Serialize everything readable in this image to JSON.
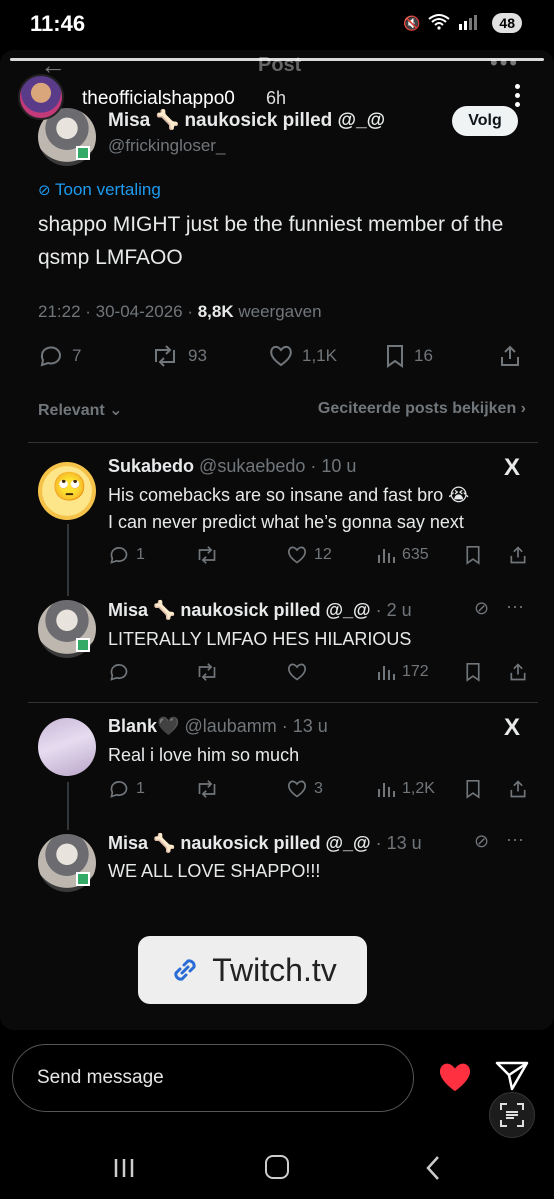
{
  "status": {
    "time": "11:46",
    "battery": "48"
  },
  "story": {
    "username": "theofficialshappo0",
    "time_ago": "6h"
  },
  "tweet": {
    "header_title": "Post",
    "author_name": "Misa 🦴 naukosick pilled @_@",
    "author_handle": "@frickingloser_",
    "follow_label": "Volg",
    "translate_label": "Toon vertaling",
    "text": "shappo MIGHT just be the funniest member of the qsmp LMFAOO",
    "meta_time": "21:22 · 30-04-2026 · ",
    "meta_views": "8,8K",
    "meta_views_label": " weergaven",
    "replies": "7",
    "reposts": "93",
    "likes": "1,1K",
    "bookmarks": "16",
    "sort_label": "Relevant ⌄",
    "quoted_label": "Geciteerde posts bekijken ›"
  },
  "replies": [
    {
      "name": "Sukabedo",
      "handle": "@sukaebedo · 10 u",
      "line1": "His comebacks are so insane and fast bro 😭",
      "line2": "I can never predict what he’s gonna say next",
      "replies": "1",
      "reposts": "",
      "likes": "12",
      "views": "635"
    },
    {
      "name": "Misa 🦴 naukosick pilled @_@",
      "handle": " · 2 u",
      "line1": "LITERALLY LMFAO HES HILARIOUS",
      "replies": "",
      "reposts": "",
      "likes": "",
      "views": "172"
    },
    {
      "name": "Blank🖤",
      "handle": "@laubamm · 13 u",
      "line1": "Real i love him so much",
      "replies": "1",
      "reposts": "",
      "likes": "3",
      "views": "1,2K"
    },
    {
      "name": "Misa 🦴 naukosick pilled @_@",
      "handle": " · 13 u",
      "line1": "WE ALL LOVE SHAPPO!!!",
      "views": ""
    }
  ],
  "link_sticker": {
    "label": "Twitch.tv"
  },
  "composer": {
    "placeholder": "Send message"
  }
}
